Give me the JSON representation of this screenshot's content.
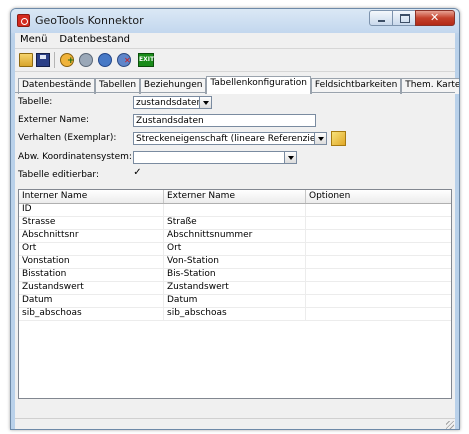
{
  "window": {
    "title": "GeoTools Konnektor"
  },
  "menu": [
    "Menü",
    "Datenbestand"
  ],
  "toolbar": {
    "icons": [
      "open-folder-icon",
      "save-icon",
      "add-icon",
      "edit-icon",
      "refresh-icon",
      "delete-icon",
      "exit-icon"
    ],
    "exit_label": "EXIT"
  },
  "tabs": [
    {
      "label": "Datenbestände",
      "active": false
    },
    {
      "label": "Tabellen",
      "active": false
    },
    {
      "label": "Beziehungen",
      "active": false
    },
    {
      "label": "Tabellenkonfiguration",
      "active": true
    },
    {
      "label": "Feldsichtbarkeiten",
      "active": false
    },
    {
      "label": "Them. Karten",
      "active": false
    }
  ],
  "form": {
    "table_label": "Tabelle:",
    "table_value": "zustandsdaten",
    "external_name_label": "Externer Name:",
    "external_name_value": "Zustandsdaten",
    "behavior_label": "Verhalten (Exemplar):",
    "behavior_value": "Streckeneigenschaft (lineare Referenzierung)",
    "coord_label": "Abw. Koordinatensystem:",
    "coord_value": "",
    "editable_label": "Tabelle editierbar:",
    "editable_checked": true,
    "editable_mark": "✓"
  },
  "grid": {
    "columns": [
      "Interner Name",
      "Externer Name",
      "Optionen"
    ],
    "rows": [
      [
        "ID",
        "",
        ""
      ],
      [
        "Strasse",
        "Straße",
        ""
      ],
      [
        "Abschnittsnr",
        "Abschnittsnummer",
        ""
      ],
      [
        "Ort",
        "Ort",
        ""
      ],
      [
        "Vonstation",
        "Von-Station",
        ""
      ],
      [
        "Bisstation",
        "Bis-Station",
        ""
      ],
      [
        "Zustandswert",
        "Zustandswert",
        ""
      ],
      [
        "Datum",
        "Datum",
        ""
      ],
      [
        "sib_abschoas",
        "sib_abschoas",
        ""
      ]
    ]
  }
}
